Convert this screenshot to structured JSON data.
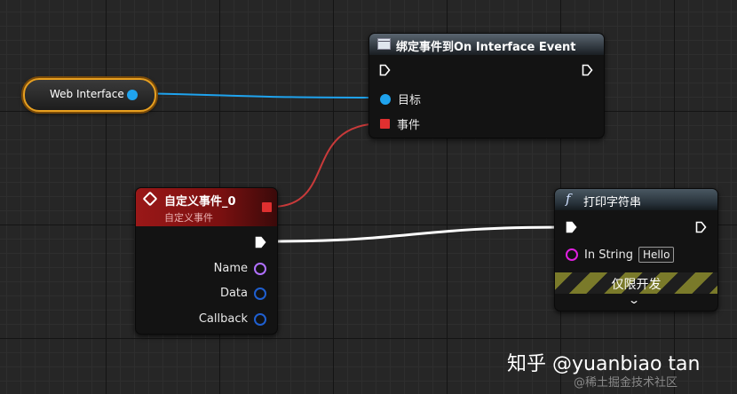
{
  "variable_node": {
    "label": "Web Interface"
  },
  "bind_node": {
    "title": "绑定事件到On Interface Event",
    "pins": {
      "target": "目标",
      "event": "事件"
    }
  },
  "custom_event_node": {
    "title": "自定义事件_0",
    "subtitle": "自定义事件",
    "pins": {
      "name": "Name",
      "data": "Data",
      "callback": "Callback"
    }
  },
  "print_node": {
    "title": "打印字符串",
    "pins": {
      "in_string": "In String",
      "in_string_value": "Hello"
    },
    "dev_only_label": "仅限开发"
  },
  "colors": {
    "object_pin": "#1fa3ee",
    "delegate_pin": "#e03030",
    "string_pin": "#e020e0",
    "name_pin": "#b070ff",
    "struct_pin": "#1f5fd0",
    "variable_border": "#e8a020"
  },
  "watermark": {
    "text": "知乎 @yuanbiao tan",
    "sub": "@稀土掘金技术社区"
  }
}
